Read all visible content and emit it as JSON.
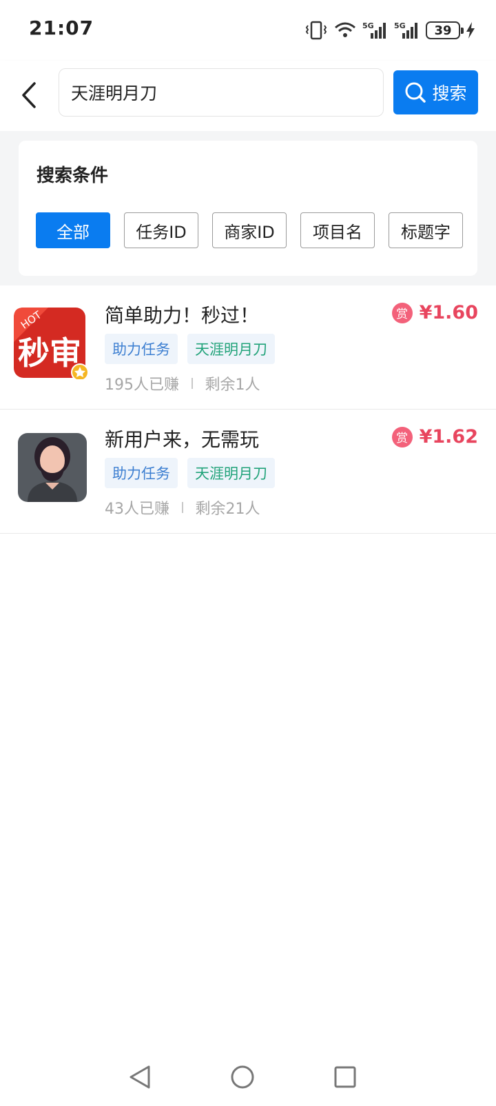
{
  "status_bar": {
    "time": "21:07",
    "battery": "39"
  },
  "header": {
    "search_value": "天涯明月刀",
    "search_button_label": "搜索"
  },
  "filter": {
    "title": "搜索条件",
    "chips": [
      {
        "label": "全部",
        "active": true
      },
      {
        "label": "任务ID",
        "active": false
      },
      {
        "label": "商家ID",
        "active": false
      },
      {
        "label": "项目名",
        "active": false
      },
      {
        "label": "标题字",
        "active": false
      }
    ]
  },
  "tasks": [
    {
      "title": "简单助力！秒过！",
      "tags": [
        "助力任务",
        "天涯明月刀"
      ],
      "earned": "195人已赚",
      "remaining": "剩余1人",
      "reward_badge": "赏",
      "price": "¥1.60",
      "icon": "miaoshen-app-icon",
      "icon_text": "秒审",
      "icon_hot": "HOT"
    },
    {
      "title": "新用户来，无需玩",
      "tags": [
        "助力任务",
        "天涯明月刀"
      ],
      "earned": "43人已赚",
      "remaining": "剩余21人",
      "reward_badge": "赏",
      "price": "¥1.62",
      "icon": "user-avatar-icon"
    }
  ],
  "colors": {
    "accent": "#0a7cf0",
    "price": "#e8455e",
    "tag_blue": "#3d7fd1",
    "tag_green": "#22a37a"
  }
}
